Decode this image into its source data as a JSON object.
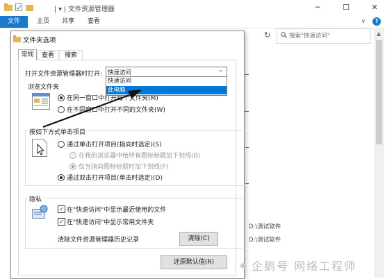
{
  "window": {
    "title": "文件资源管理器",
    "title_prefix": "| ▾ |",
    "ribbon_tabs": [
      "文件",
      "主页",
      "共享",
      "查看"
    ],
    "help_label": "?",
    "search_placeholder": "搜索\"快速访问\"",
    "controls": {
      "minimize": "─",
      "maximize": "☐",
      "close": "✕"
    }
  },
  "background_rows": [
    "D:\\测试软件",
    "D:\\测试软件"
  ],
  "dialog": {
    "title": "文件夹选项",
    "tabs": [
      "常规",
      "查看",
      "搜索"
    ],
    "open_label": "打开文件资源管理器时打开:",
    "dropdown": {
      "selected": "快速访问",
      "options": [
        "快速访问",
        "此电脑"
      ],
      "highlighted_index": 1
    },
    "browse_group": {
      "title": "浏览文件夹",
      "options": [
        "在同一窗口中打开每个文件夹(M)",
        "在不同窗口中打开不同的文件夹(W)"
      ],
      "selected_index": 0
    },
    "click_group": {
      "title": "按如下方式单击项目",
      "single_click": "通过单击打开项目(指向时选定)(S)",
      "sub_options": [
        "在我的浏览器中给所有图标标题加下划线(B)",
        "仅当指向图标标题时加下划线(P)"
      ],
      "double_click": "通过双击打开项目(单击时选定)(D)",
      "selected": "double"
    },
    "privacy_group": {
      "title": "隐私",
      "checks": [
        {
          "label": "在\"快速访问\"中显示最近使用的文件",
          "checked": true
        },
        {
          "label": "在\"快速访问\"中显示常用文件夹",
          "checked": true
        }
      ],
      "clear_label": "清除文件资源管理器历史记录",
      "clear_button": "清除(C)"
    },
    "restore_button": "还原默认值(R)"
  },
  "watermark": "企鹅号 网络工程师",
  "colors": {
    "accent": "#1979ca",
    "highlight": "#0078d7"
  }
}
